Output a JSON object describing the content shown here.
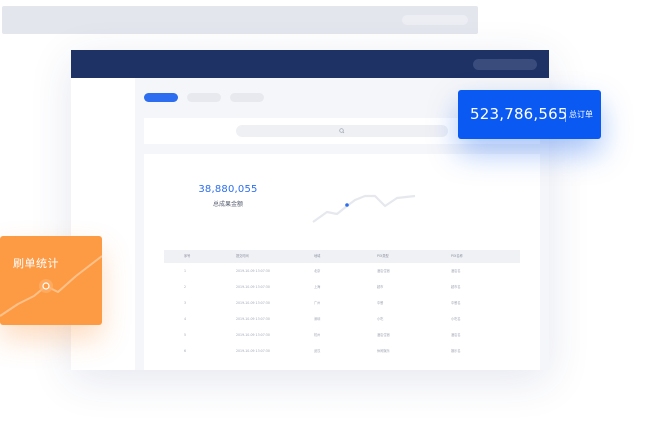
{
  "order_card": {
    "value": "523,786,565",
    "label": "总订单"
  },
  "brush_card": {
    "title": "刷单统计"
  },
  "stat": {
    "value": "38,880,055",
    "label": "总成果金额"
  },
  "table": {
    "headers": [
      "序号",
      "提交时间",
      "地域",
      "POI类型",
      "POI名称"
    ],
    "rows": [
      [
        "1",
        "2019-10-09 13:07:30",
        "北京",
        "酒店住宿",
        "酒店名"
      ],
      [
        "2",
        "2019-10-09 13:07:30",
        "上海",
        "超市",
        "超市名"
      ],
      [
        "3",
        "2019-10-09 13:07:30",
        "广州",
        "中餐",
        "中餐名"
      ],
      [
        "4",
        "2019-10-09 13:07:30",
        "深圳",
        "小吃",
        "小吃名"
      ],
      [
        "5",
        "2019-10-09 13:07:30",
        "杭州",
        "酒店住宿",
        "酒店名"
      ],
      [
        "6",
        "2019-10-09 13:07:30",
        "武汉",
        "休闲娱乐",
        "娱乐名"
      ]
    ]
  },
  "colors": {
    "accent": "#2d6ef0",
    "header": "#1e3266",
    "order_card": "#0a59f2",
    "brush_card": "#fd9a44"
  }
}
